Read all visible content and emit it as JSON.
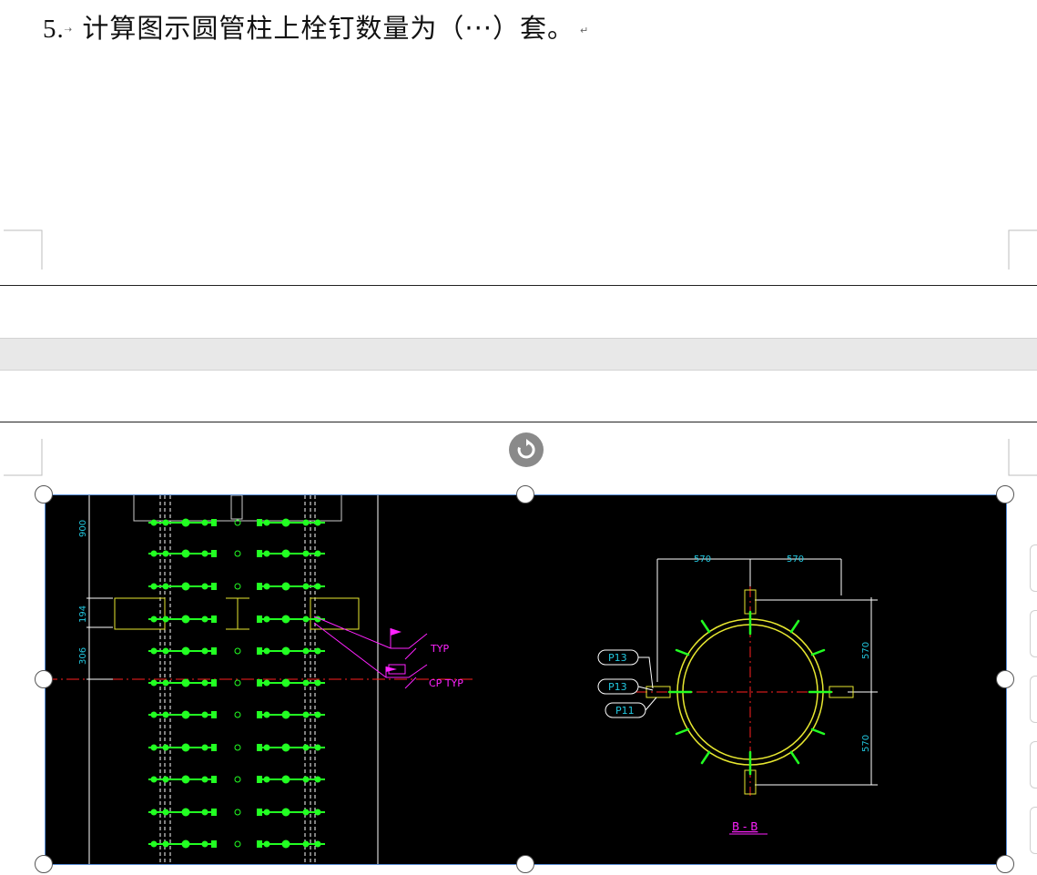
{
  "question": {
    "number": "5.",
    "text": "计算图示圆管柱上栓钉数量为（···）套。"
  },
  "drawing": {
    "dims_left": [
      "900",
      "194",
      "306"
    ],
    "dims_right": [
      "570",
      "570",
      "570",
      "570"
    ],
    "annotations": [
      "TYP",
      "CP TYP"
    ],
    "part_tags": [
      "P13",
      "P13",
      "P11"
    ],
    "section_title": "B - B",
    "colors": {
      "background": "#000000",
      "studs": "#22ff22",
      "steel": "#e8e830",
      "dims": "#22c8e0",
      "notes": "#ff22ff",
      "centerline": "#ff2020",
      "lines": "#ffffff"
    }
  },
  "icons": {
    "rotate": "rotate-icon"
  }
}
